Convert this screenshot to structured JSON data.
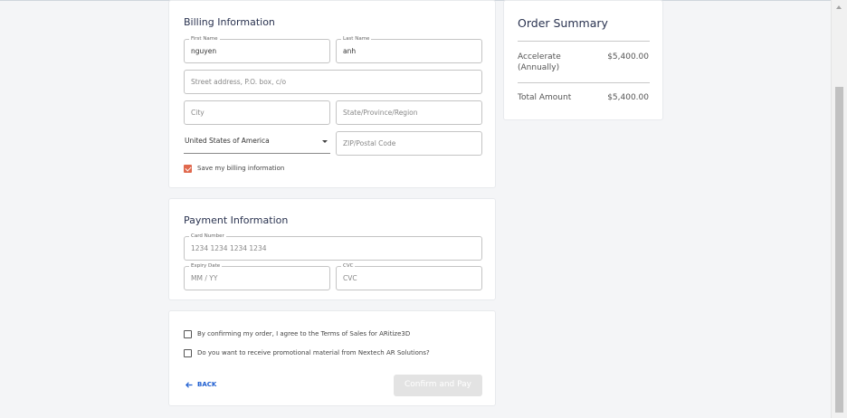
{
  "billing": {
    "title": "Billing Information",
    "first_name": {
      "label": "First Name",
      "value": "nguyen"
    },
    "last_name": {
      "label": "Last Name",
      "value": "anh"
    },
    "street": {
      "placeholder": "Street address, P.O. box, c/o"
    },
    "city": {
      "placeholder": "City"
    },
    "state": {
      "placeholder": "State/Province/Region"
    },
    "country": {
      "value": "United States of America"
    },
    "zip": {
      "placeholder": "ZIP/Postal Code"
    },
    "save_label": "Save my billing information",
    "save_checked": true
  },
  "payment": {
    "title": "Payment Information",
    "card_number": {
      "label": "Card Number",
      "placeholder": "1234 1234 1234 1234"
    },
    "expiry": {
      "label": "Expiry Date",
      "placeholder": "MM / YY"
    },
    "cvc": {
      "label": "CVC",
      "placeholder": "CVC"
    }
  },
  "confirm": {
    "terms_label": "By confirming my order, I agree to the Terms of Sales for ARitize3D",
    "promo_label": "Do you want to receive promotional material from Nextech AR Solutions?",
    "back_label": "BACK",
    "confirm_label": "Confirm and Pay"
  },
  "summary": {
    "title": "Order Summary",
    "item_name": "Accelerate\n(Annually)",
    "item_name_line1": "Accelerate",
    "item_name_line2": "(Annually)",
    "item_price": "$5,400.00",
    "total_label": "Total Amount",
    "total_price": "$5,400.00"
  },
  "colors": {
    "accent": "#e0694e",
    "link": "#1f5fd1",
    "disabled_button": "#e3e3e3"
  }
}
